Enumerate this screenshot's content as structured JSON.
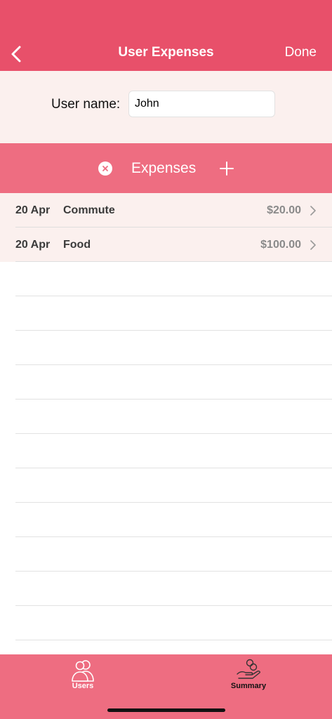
{
  "nav": {
    "title": "User Expenses",
    "done_label": "Done",
    "back_icon": "chevron-left-icon"
  },
  "user": {
    "label": "User name:",
    "value": "John"
  },
  "expenses_header": {
    "title": "Expenses",
    "clear_icon": "close-circle-icon",
    "add_icon": "plus-icon"
  },
  "expenses": [
    {
      "date": "20 Apr",
      "description": "Commute",
      "amount": "$20.00"
    },
    {
      "date": "20 Apr",
      "description": "Food",
      "amount": "$100.00"
    }
  ],
  "tabs": [
    {
      "label": "Users",
      "icon": "users-icon",
      "selected": true
    },
    {
      "label": "Summary",
      "icon": "summary-icon",
      "selected": false
    }
  ],
  "colors": {
    "nav_bg": "#e8506a",
    "accent": "#ee6d81",
    "row_bg": "#fbf0ee",
    "amount_text": "#8a8a8a"
  }
}
